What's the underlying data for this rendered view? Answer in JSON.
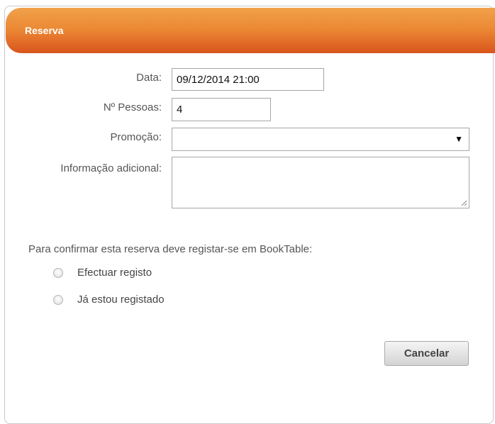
{
  "dialog": {
    "title": "Reserva"
  },
  "form": {
    "date_label": "Data:",
    "date_value": "09/12/2014 21:00",
    "people_label": "Nº Pessoas:",
    "people_value": "4",
    "promo_label": "Promoção:",
    "promo_value": "",
    "info_label": "Informação adicional:",
    "info_value": ""
  },
  "registration": {
    "prompt": "Para confirmar esta reserva deve registar-se em BookTable:",
    "options": [
      {
        "label": "Efectuar registo",
        "selected": false
      },
      {
        "label": "Já estou registado",
        "selected": false
      }
    ]
  },
  "actions": {
    "cancel_label": "Cancelar"
  },
  "icons": {
    "dropdown": "chevron-down-icon",
    "resize": "resize-grip-icon"
  },
  "colors": {
    "header_top": "#f0a14a",
    "header_bottom": "#d9551d",
    "label_text": "#555555"
  }
}
